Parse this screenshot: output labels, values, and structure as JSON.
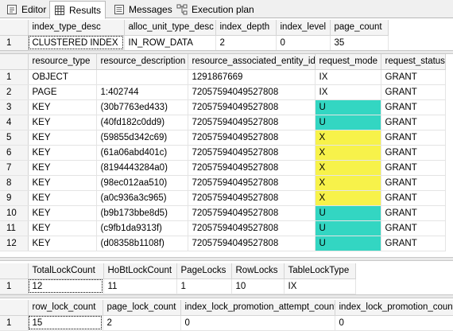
{
  "tabs": [
    {
      "label": "Editor",
      "icon": "editor-icon"
    },
    {
      "label": "Results",
      "icon": "grid-icon"
    },
    {
      "label": "Messages",
      "icon": "messages-icon"
    },
    {
      "label": "Execution plan",
      "icon": "execution-plan-icon"
    }
  ],
  "active_tab": "Results",
  "highlight_colors": {
    "U": "#33d6c2",
    "X": "#f7f24a"
  },
  "grid1": {
    "columns": [
      "index_type_desc",
      "alloc_unit_type_desc",
      "index_depth",
      "index_level",
      "page_count"
    ],
    "rows": [
      {
        "n": "1",
        "cells": [
          "CLUSTERED INDEX",
          "IN_ROW_DATA",
          "2",
          "0",
          "35"
        ]
      }
    ]
  },
  "grid2": {
    "columns": [
      "resource_type",
      "resource_description",
      "resource_associated_entity_id",
      "request_mode",
      "request_status"
    ],
    "rows": [
      {
        "n": "1",
        "cells": [
          "OBJECT",
          "",
          "1291867669",
          "IX",
          "GRANT"
        ]
      },
      {
        "n": "2",
        "cells": [
          "PAGE",
          "1:402744",
          "72057594049527808",
          "IX",
          "GRANT"
        ]
      },
      {
        "n": "3",
        "cells": [
          "KEY",
          "(30b7763ed433)",
          "72057594049527808",
          "U",
          "GRANT"
        ]
      },
      {
        "n": "4",
        "cells": [
          "KEY",
          "(40fd182c0dd9)",
          "72057594049527808",
          "U",
          "GRANT"
        ]
      },
      {
        "n": "5",
        "cells": [
          "KEY",
          "(59855d342c69)",
          "72057594049527808",
          "X",
          "GRANT"
        ]
      },
      {
        "n": "6",
        "cells": [
          "KEY",
          "(61a06abd401c)",
          "72057594049527808",
          "X",
          "GRANT"
        ]
      },
      {
        "n": "7",
        "cells": [
          "KEY",
          "(8194443284a0)",
          "72057594049527808",
          "X",
          "GRANT"
        ]
      },
      {
        "n": "8",
        "cells": [
          "KEY",
          "(98ec012aa510)",
          "72057594049527808",
          "X",
          "GRANT"
        ]
      },
      {
        "n": "9",
        "cells": [
          "KEY",
          "(a0c936a3c965)",
          "72057594049527808",
          "X",
          "GRANT"
        ]
      },
      {
        "n": "10",
        "cells": [
          "KEY",
          "(b9b173bbe8d5)",
          "72057594049527808",
          "U",
          "GRANT"
        ]
      },
      {
        "n": "11",
        "cells": [
          "KEY",
          "(c9fb1da9313f)",
          "72057594049527808",
          "U",
          "GRANT"
        ]
      },
      {
        "n": "12",
        "cells": [
          "KEY",
          "(d08358b1108f)",
          "72057594049527808",
          "U",
          "GRANT"
        ]
      }
    ]
  },
  "grid3": {
    "columns": [
      "TotalLockCount",
      "HoBtLockCount",
      "PageLocks",
      "RowLocks",
      "TableLockType"
    ],
    "rows": [
      {
        "n": "1",
        "cells": [
          "12",
          "11",
          "1",
          "10",
          "IX"
        ]
      }
    ]
  },
  "grid4": {
    "columns": [
      "row_lock_count",
      "page_lock_count",
      "index_lock_promotion_attempt_count",
      "index_lock_promotion_count"
    ],
    "rows": [
      {
        "n": "1",
        "cells": [
          "15",
          "2",
          "0",
          "0"
        ]
      }
    ]
  }
}
